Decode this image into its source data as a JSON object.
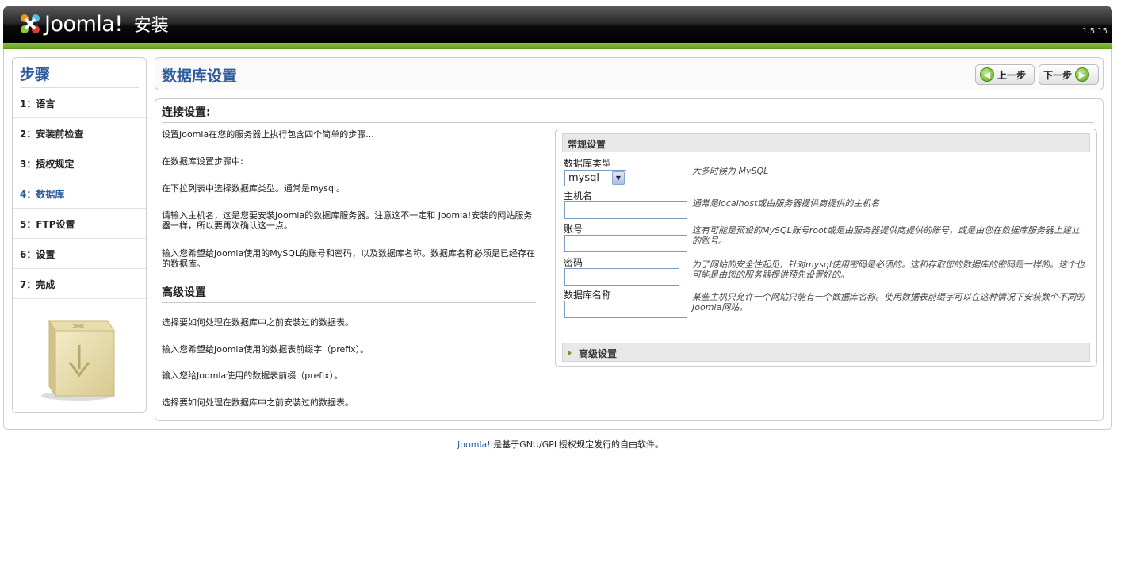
{
  "header": {
    "logo_text": "Joomla!",
    "install_label": "安装",
    "version": "1.5.15"
  },
  "steps": {
    "title": "步骤",
    "items": [
      {
        "label": "1：语言"
      },
      {
        "label": "2：安装前检查"
      },
      {
        "label": "3：授权规定"
      },
      {
        "label": "4：数据库",
        "active": true
      },
      {
        "label": "5：FTP设置"
      },
      {
        "label": "6：设置"
      },
      {
        "label": "7：完成"
      }
    ]
  },
  "page": {
    "title": "数据库设置",
    "prev_label": "上一步",
    "next_label": "下一步"
  },
  "connection": {
    "title": "连接设置:",
    "paragraphs": [
      "设置Joomla在您的服务器上执行包含四个简单的步骤...",
      "在数据库设置步骤中:",
      "在下拉列表中选择数据库类型。通常是mysql。",
      "请输入主机名，这是您要安装Joomla的数据库服务器。注意这不一定和 Joomla!安装的网站服务器一样，所以要再次确认这一点。",
      "输入您希望给Joomla使用的MySQL的账号和密码，以及数据库名称。数据库名称必须是已经存在的数据库。"
    ]
  },
  "advanced": {
    "title": "高级设置",
    "paragraphs": [
      "选择要如何处理在数据库中之前安装过的数据表。",
      "输入您希望给Joomla使用的数据表前缀字（prefix）。",
      "输入您给Joomla使用的数据表前缀（prefix）。",
      "选择要如何处理在数据库中之前安装过的数据表。"
    ]
  },
  "form": {
    "general_title": "常规设置",
    "db_type": {
      "label": "数据库类型",
      "value": "mysql",
      "hint": "大多时候为 MySQL"
    },
    "host": {
      "label": "主机名",
      "value": "",
      "hint": "通常是localhost或由服务器提供商提供的主机名"
    },
    "user": {
      "label": "账号",
      "value": "",
      "hint": "这有可能是预设的MySQL账号root或是由服务器提供商提供的账号，或是由您在数据库服务器上建立的账号。"
    },
    "password": {
      "label": "密码",
      "value": "",
      "hint": "为了网站的安全性起见，针对mysql使用密码是必须的。这和存取您的数据库的密码是一样的。这个也可能是由您的服务器提供预先设置好的。"
    },
    "db_name": {
      "label": "数据库名称",
      "value": "",
      "hint": "某些主机只允许一个网站只能有一个数据库名称。使用数据表前缀字可以在这种情况下安装数个不同的Joomla网站。"
    },
    "advanced_title": "高级设置"
  },
  "footer": {
    "link": "Joomla!",
    "text": " 是基于GNU/GPL授权规定发行的自由软件。"
  }
}
